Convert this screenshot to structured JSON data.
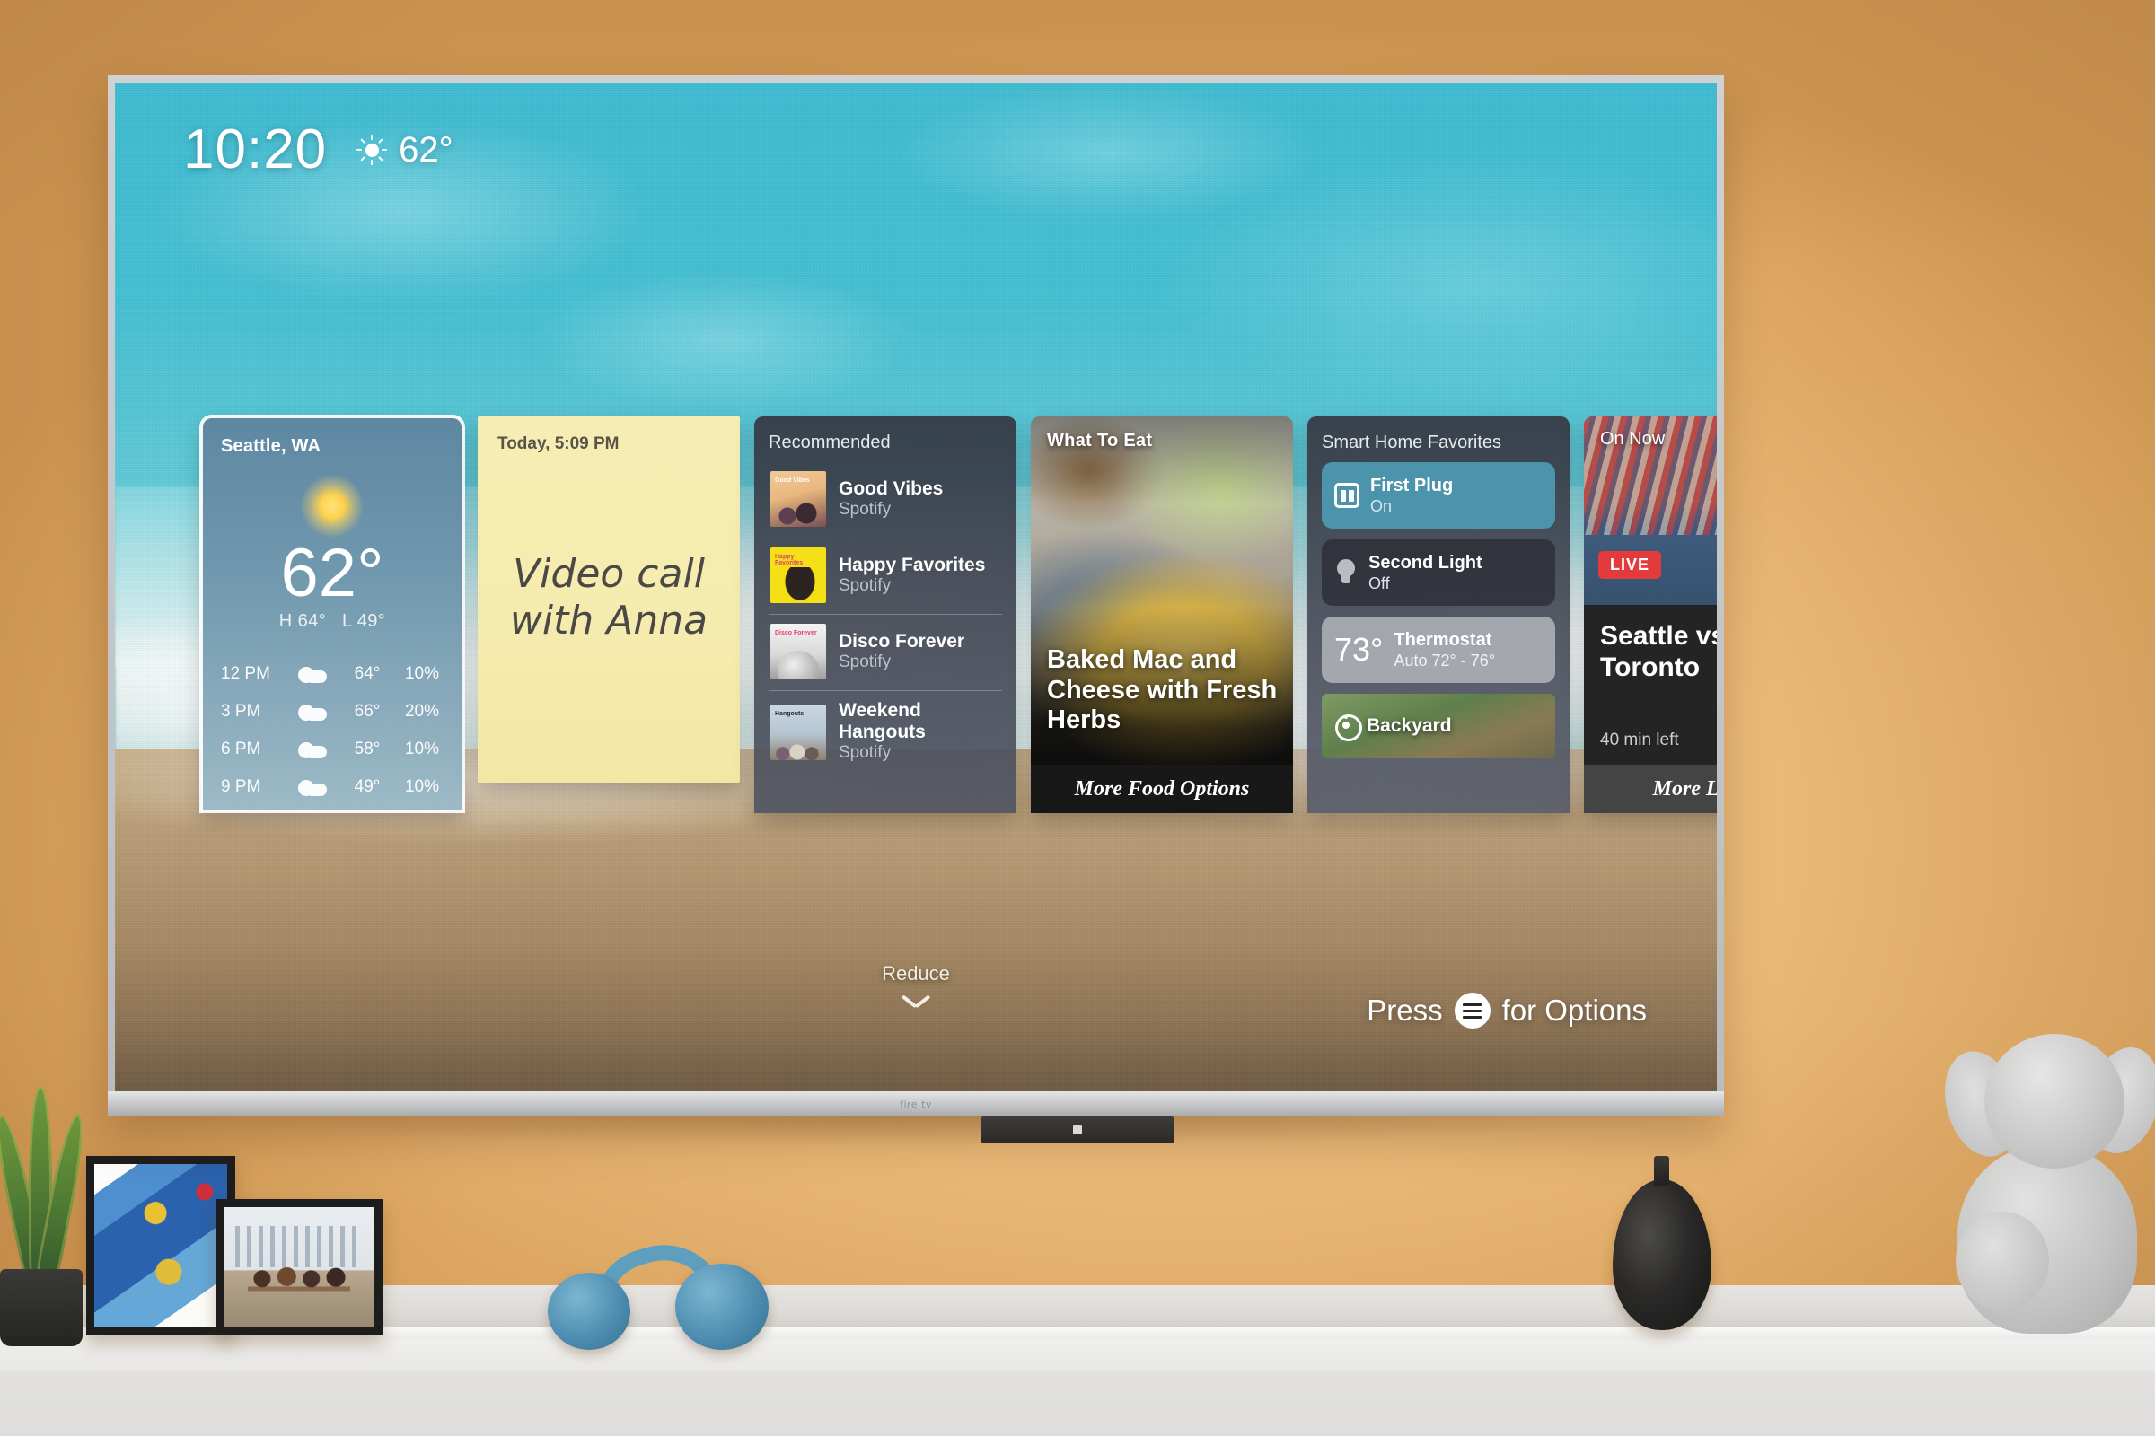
{
  "device": {
    "brand_logo": "fire tv"
  },
  "status_bar": {
    "clock": "10:20",
    "weather_icon": "sun-icon",
    "temperature": "62°"
  },
  "cards": {
    "weather": {
      "name": "weather-card",
      "city": "Seattle, WA",
      "icon": "sun-icon",
      "current_temp": "62°",
      "high_label": "H 64°",
      "low_label": "L 49°",
      "hourly": [
        {
          "time": "12 PM",
          "icon": "cloud-icon",
          "temp": "64°",
          "precip": "10%"
        },
        {
          "time": "3 PM",
          "icon": "cloud-icon",
          "temp": "66°",
          "precip": "20%"
        },
        {
          "time": "6 PM",
          "icon": "cloud-icon",
          "temp": "58°",
          "precip": "10%"
        },
        {
          "time": "9 PM",
          "icon": "cloud-icon",
          "temp": "49°",
          "precip": "10%"
        }
      ]
    },
    "note": {
      "name": "sticky-note-card",
      "timestamp": "Today, 5:09 PM",
      "body": "Video call with Anna"
    },
    "recommended": {
      "name": "recommended-card",
      "title": "Recommended",
      "items": [
        {
          "name": "Good Vibes",
          "source": "Spotify",
          "art_label": "Good Vibes"
        },
        {
          "name": "Happy Favorites",
          "source": "Spotify",
          "art_label": "Happy Favorites"
        },
        {
          "name": "Disco Forever",
          "source": "Spotify",
          "art_label": "Disco Forever"
        },
        {
          "name": "Weekend Hangouts",
          "source": "Spotify",
          "art_label": "Hangouts"
        }
      ]
    },
    "food": {
      "name": "what-to-eat-card",
      "header": "What To Eat",
      "title": "Baked Mac and Cheese with Fresh Herbs",
      "footer": "More Food Options"
    },
    "smart_home": {
      "name": "smart-home-card",
      "title": "Smart Home Favorites",
      "devices": [
        {
          "name": "First Plug",
          "state": "On",
          "icon": "plug-icon",
          "active": true
        },
        {
          "name": "Second Light",
          "state": "Off",
          "icon": "bulb-icon",
          "active": false
        }
      ],
      "thermostat": {
        "value": "73°",
        "name": "Thermostat",
        "mode": "Auto 72° - 76°"
      },
      "camera": {
        "name": "Backyard",
        "icon": "camera-icon"
      }
    },
    "live": {
      "name": "on-now-card",
      "header": "On Now",
      "badge": "LIVE",
      "title": "Seattle vs. Toronto",
      "time_left": "40 min left",
      "footer": "More Live TV"
    }
  },
  "controls": {
    "reduce_label": "Reduce",
    "reduce_icon": "chevron-down-icon",
    "options_prefix": "Press",
    "options_icon": "hamburger-menu-icon",
    "options_suffix": "for Options"
  },
  "colors": {
    "accent_teal": "#4b94ab",
    "live_red": "#e33b3b",
    "note_yellow": "#f6ebae",
    "wall": "#ecbb79"
  }
}
